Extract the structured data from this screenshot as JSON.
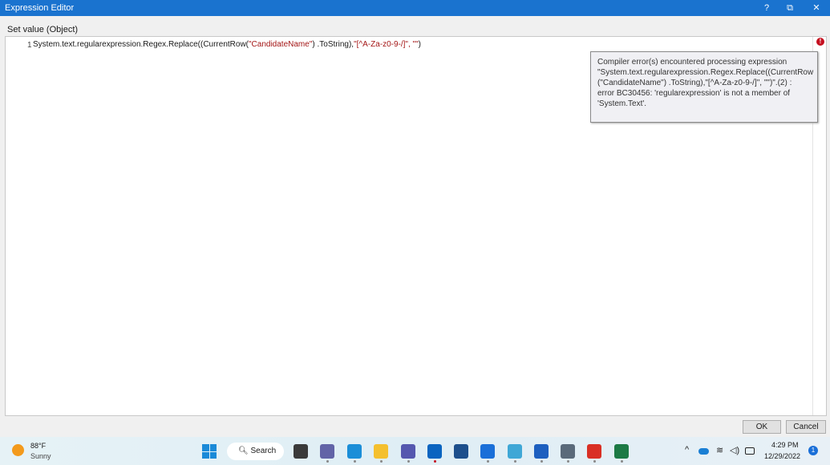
{
  "window": {
    "title": "Expression Editor",
    "help": "?",
    "restore": "⧉",
    "close": "✕"
  },
  "editor": {
    "label": "Set value (Object)",
    "line_number": "1",
    "code_prefix": "System.text.regularexpression.Regex.Replace((CurrentRow(",
    "code_string1": "\"CandidateName\"",
    "code_mid": ") .ToString),",
    "code_string2": "\"[^A-Za-z0-9-/]\", \"\"",
    "code_suffix": ")",
    "error_icon": "!",
    "error_tooltip": "Compiler error(s) encountered processing expression \"System.text.regularexpression.Regex.Replace((CurrentRow (\"CandidateName\") .ToString),\"[^A-Za-z0-9-/]\", \"\")\".(2) : error BC30456: 'regularexpression' is not a member of 'System.Text'."
  },
  "buttons": {
    "ok": "OK",
    "cancel": "Cancel"
  },
  "taskbar": {
    "weather": {
      "temp": "88°F",
      "condition": "Sunny"
    },
    "search_label": "Search",
    "apps": [
      {
        "name": "file-explorer-task",
        "color": "#3a3a3a"
      },
      {
        "name": "teams-chat",
        "color": "#6264a7"
      },
      {
        "name": "edge",
        "color": "#1b8ed8"
      },
      {
        "name": "file-explorer",
        "color": "#f4c02f"
      },
      {
        "name": "teams",
        "color": "#5558af"
      },
      {
        "name": "outlook",
        "color": "#0a64c0"
      },
      {
        "name": "store",
        "color": "#1d4f8c"
      },
      {
        "name": "studio",
        "color": "#1a6fd8"
      },
      {
        "name": "notepad",
        "color": "#3fa7d6"
      },
      {
        "name": "word",
        "color": "#1d5fbf"
      },
      {
        "name": "settings",
        "color": "#5a6a7a"
      },
      {
        "name": "chrome",
        "color": "#d93025"
      },
      {
        "name": "excel",
        "color": "#1d7a45"
      }
    ],
    "time": "4:29 PM",
    "date": "12/29/2022",
    "notification_count": "1"
  }
}
